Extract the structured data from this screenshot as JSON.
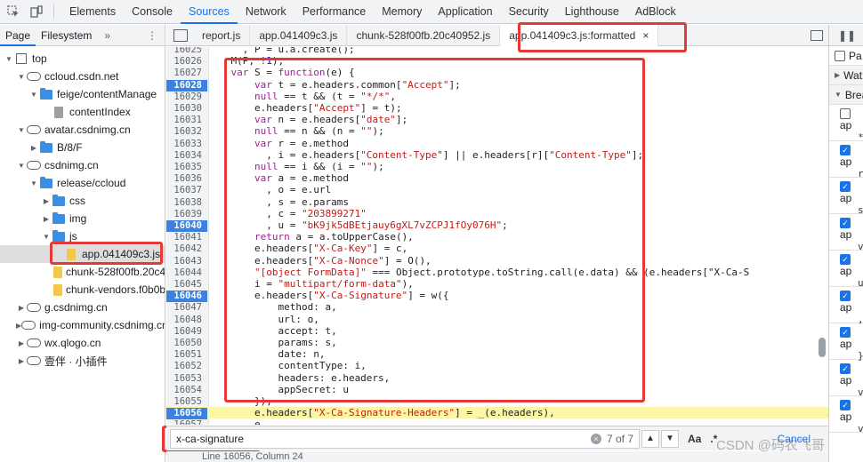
{
  "topbar": {
    "tabs": [
      "Elements",
      "Console",
      "Sources",
      "Network",
      "Performance",
      "Memory",
      "Application",
      "Security",
      "Lighthouse",
      "AdBlock"
    ],
    "active_tab": "Sources"
  },
  "navigator": {
    "tabs": [
      "Page",
      "Filesystem"
    ],
    "more": "»",
    "kebab": "⋮",
    "tree": [
      {
        "label": "top",
        "depth": 0,
        "icon": "frame-icon",
        "expanded": true
      },
      {
        "label": "ccloud.csdn.net",
        "depth": 1,
        "icon": "cloud-icon",
        "expanded": true
      },
      {
        "label": "feige/contentManage",
        "depth": 2,
        "icon": "folder-icon",
        "expanded": true
      },
      {
        "label": "contentIndex",
        "depth": 3,
        "icon": "file-icon"
      },
      {
        "label": "avatar.csdnimg.cn",
        "depth": 1,
        "icon": "cloud-icon",
        "expanded": true
      },
      {
        "label": "B/8/F",
        "depth": 2,
        "icon": "folder-icon",
        "expanded": false
      },
      {
        "label": "csdnimg.cn",
        "depth": 1,
        "icon": "cloud-icon",
        "expanded": true
      },
      {
        "label": "release/ccloud",
        "depth": 2,
        "icon": "folder-icon",
        "expanded": true
      },
      {
        "label": "css",
        "depth": 3,
        "icon": "folder-icon",
        "expanded": false
      },
      {
        "label": "img",
        "depth": 3,
        "icon": "folder-icon",
        "expanded": false
      },
      {
        "label": "js",
        "depth": 3,
        "icon": "folder-icon",
        "expanded": true
      },
      {
        "label": "app.041409c3.js",
        "depth": 4,
        "icon": "js-file-icon",
        "selected": true
      },
      {
        "label": "chunk-528f00fb.20c40952.js",
        "depth": 4,
        "icon": "js-file-icon"
      },
      {
        "label": "chunk-vendors.f0b0b8d2.js",
        "depth": 4,
        "icon": "js-file-icon"
      },
      {
        "label": "g.csdnimg.cn",
        "depth": 1,
        "icon": "cloud-icon",
        "expanded": false
      },
      {
        "label": "img-community.csdnimg.cn",
        "depth": 1,
        "icon": "cloud-icon",
        "expanded": false
      },
      {
        "label": "wx.qlogo.cn",
        "depth": 1,
        "icon": "cloud-icon",
        "expanded": false
      },
      {
        "label": "壹伴 · 小插件",
        "depth": 1,
        "icon": "cloud-icon",
        "expanded": false
      }
    ]
  },
  "editor_tabs": [
    {
      "label": "report.js"
    },
    {
      "label": "app.041409c3.js"
    },
    {
      "label": "chunk-528f00fb.20c40952.js"
    },
    {
      "label": "app.041409c3.js:formatted",
      "active": true,
      "close": "×"
    }
  ],
  "code_lines": [
    {
      "n": "16025",
      "t": "      , P = u.a.create();"
    },
    {
      "n": "16026",
      "t": "    M(P, !1);"
    },
    {
      "n": "16027",
      "t": "    var S = function(e) {"
    },
    {
      "n": "16028",
      "t": "        var t = e.headers.common[\"Accept\"];",
      "bp": true
    },
    {
      "n": "16029",
      "t": "        null == t && (t = \"*/*\","
    },
    {
      "n": "16030",
      "t": "        e.headers[\"Accept\"] = t);"
    },
    {
      "n": "16031",
      "t": "        var n = e.headers[\"date\"];"
    },
    {
      "n": "16032",
      "t": "        null == n && (n = \"\");"
    },
    {
      "n": "16033",
      "t": "        var r = e.method"
    },
    {
      "n": "16034",
      "t": "          , i = e.headers[\"Content-Type\"] || e.headers[r][\"Content-Type\"];"
    },
    {
      "n": "16035",
      "t": "        null == i && (i = \"\");"
    },
    {
      "n": "16036",
      "t": "        var a = e.method"
    },
    {
      "n": "16037",
      "t": "          , o = e.url"
    },
    {
      "n": "16038",
      "t": "          , s = e.params"
    },
    {
      "n": "16039",
      "t": "          , c = \"203899271\""
    },
    {
      "n": "16040",
      "t": "          , u = \"bK9jk5dBEtjauy6gXL7vZCPJ1fOy076H\";",
      "bp": true
    },
    {
      "n": "16041",
      "t": "        return a = a.toUpperCase(),"
    },
    {
      "n": "16042",
      "t": "        e.headers[\"X-Ca-Key\"] = c,"
    },
    {
      "n": "16043",
      "t": "        e.headers[\"X-Ca-Nonce\"] = O(),"
    },
    {
      "n": "16044",
      "t": "        \"[object FormData]\" === Object.prototype.toString.call(e.data) && (e.headers[\"X-Ca-S"
    },
    {
      "n": "16045",
      "t": "        i = \"multipart/form-data\"),"
    },
    {
      "n": "16046",
      "t": "        e.headers[\"X-Ca-Signature\"] = w({",
      "bp": true
    },
    {
      "n": "16047",
      "t": "            method: a,"
    },
    {
      "n": "16048",
      "t": "            url: o,"
    },
    {
      "n": "16049",
      "t": "            accept: t,"
    },
    {
      "n": "16050",
      "t": "            params: s,"
    },
    {
      "n": "16051",
      "t": "            date: n,"
    },
    {
      "n": "16052",
      "t": "            contentType: i,"
    },
    {
      "n": "16053",
      "t": "            headers: e.headers,"
    },
    {
      "n": "16054",
      "t": "            appSecret: u"
    },
    {
      "n": "16055",
      "t": "        }),"
    },
    {
      "n": "16056",
      "t": "        e.headers[\"X-Ca-Signature-Headers\"] = _(e.headers),",
      "bp": true,
      "hl": true
    },
    {
      "n": "16057",
      "t": "        e"
    }
  ],
  "right_panel": {
    "pause_label": "❚❚",
    "pause_checkbox_label": "Pa",
    "watch_label": "Wat",
    "breakpoints_label": "Brea",
    "breakpoint_items": [
      {
        "title": "ap",
        "snippet": "*",
        "checked": false
      },
      {
        "title": "ap",
        "snippet": "r",
        "checked": true
      },
      {
        "title": "ap",
        "snippet": "s",
        "checked": true
      },
      {
        "title": "ap",
        "snippet": "v",
        "checked": true
      },
      {
        "title": "ap",
        "snippet": "u",
        "checked": true
      },
      {
        "title": "ap",
        "snippet": ",",
        "checked": true
      },
      {
        "title": "ap",
        "snippet": "}",
        "checked": true
      },
      {
        "title": "ap",
        "snippet": "v",
        "checked": true
      },
      {
        "title": "ap",
        "snippet": "v",
        "checked": true
      }
    ]
  },
  "search": {
    "value": "x-ca-signature",
    "clear": "×",
    "count": "7 of 7",
    "prev": "▲",
    "next": "▼",
    "match_case": "Aa",
    "regex": ".*",
    "cancel": "Cancel"
  },
  "status": {
    "text": "Line 16056, Column 24"
  },
  "watermark": "CSDN @码农飞哥"
}
